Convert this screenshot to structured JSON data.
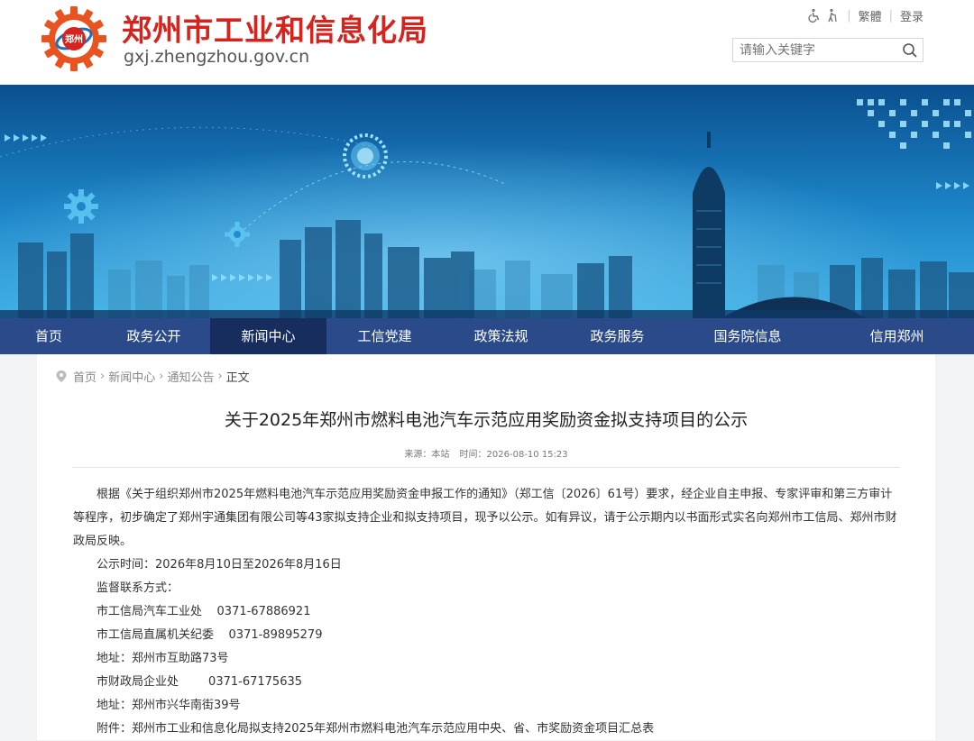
{
  "header": {
    "site_title": "郑州市工业和信息化局",
    "site_domain": "gxj.zhengzhou.gov.cn",
    "logo_text": "郑州",
    "links": {
      "traditional": "繁體",
      "login": "登录"
    },
    "search": {
      "placeholder": "请输入关键字"
    }
  },
  "nav": {
    "items": [
      {
        "label": "首页"
      },
      {
        "label": "政务公开"
      },
      {
        "label": "新闻中心"
      },
      {
        "label": "工信党建"
      },
      {
        "label": "政策法规"
      },
      {
        "label": "政务服务"
      },
      {
        "label": "国务院信息"
      },
      {
        "label": "信用郑州"
      }
    ],
    "active_index": 2
  },
  "breadcrumb": {
    "items": [
      "首页",
      "新闻中心",
      "通知公告"
    ],
    "current": "正文"
  },
  "article": {
    "title": "关于2025年郑州市燃料电池汽车示范应用奖励资金拟支持项目的公示",
    "source": "来源：本站",
    "time": "时间：2026-08-10 15:23",
    "paragraph": "根据《关于组织郑州市2025年燃料电池汽车示范应用奖励资金申报工作的通知》（郑工信〔2026〕61号）要求，经企业自主申报、专家评审和第三方审计等程序，初步确定了郑州宇通集团有限公司等43家拟支持企业和拟支持项目，现予以公示。如有异议，请于公示期内以书面形式实名向郑州市工信局、郑州市财政局反映。",
    "lines": [
      "公示时间：2026年8月10日至2026年8月16日",
      "监督联系方式：",
      "市工信局汽车工业处    0371-67886921",
      "市工信局直属机关纪委    0371-89895279",
      "地址：郑州市互助路73号",
      "市财政局企业处        0371-67175635",
      "地址：郑州市兴华南街39号",
      "附件：郑州市工业和信息化局拟支持2025年郑州市燃料电池汽车示范应用中央、省、市奖励资金项目汇总表"
    ]
  },
  "colors": {
    "brand_red": "#d6231d",
    "nav_bg": "#2b4a8a",
    "nav_active": "#162d5e"
  }
}
